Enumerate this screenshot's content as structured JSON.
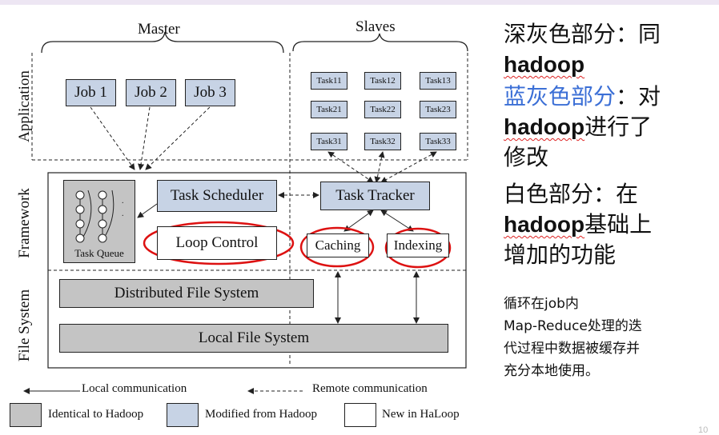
{
  "diagram": {
    "headers": {
      "master": "Master",
      "slaves": "Slaves"
    },
    "layers": {
      "application": "Application",
      "framework": "Framework",
      "filesystem": "File System"
    },
    "jobs": [
      "Job 1",
      "Job 2",
      "Job 3"
    ],
    "tasks": [
      [
        "Task11",
        "Task12",
        "Task13"
      ],
      [
        "Task21",
        "Task22",
        "Task23"
      ],
      [
        "Task31",
        "Task32",
        "Task33"
      ]
    ],
    "task_queue": "Task Queue",
    "task_scheduler": "Task Scheduler",
    "task_tracker": "Task Tracker",
    "loop_control": "Loop Control",
    "caching": "Caching",
    "indexing": "Indexing",
    "dfs": "Distributed File System",
    "lfs": "Local File System",
    "legend": {
      "local": "Local communication",
      "remote": "Remote communication",
      "identical": "Identical to Hadoop",
      "modified": "Modified from Hadoop",
      "new": "New in HaLoop"
    }
  },
  "notes": {
    "l1_a": "深灰色部分：同",
    "l2_a": "hadoop",
    "l3_a": "蓝灰色部分",
    "l3_b": "：对",
    "l4_a": "hadoop",
    "l4_b": "进行了",
    "l5_a": "修改",
    "l6_a": "白色部分：在",
    "l7_a": "hadoop",
    "l7_b": "基础上",
    "l8_a": "增加的功能",
    "p1": "循环在job内",
    "p2": "Map-Reduce处理的迭",
    "p3": "代过程中数据被缓存并",
    "p4": "充分本地使用。"
  },
  "page_number": "10",
  "colors": {
    "identical": "#c4c4c4",
    "modified": "#c7d3e5",
    "highlight_blue": "#3b6fd6",
    "circle_red": "#dd1111"
  }
}
